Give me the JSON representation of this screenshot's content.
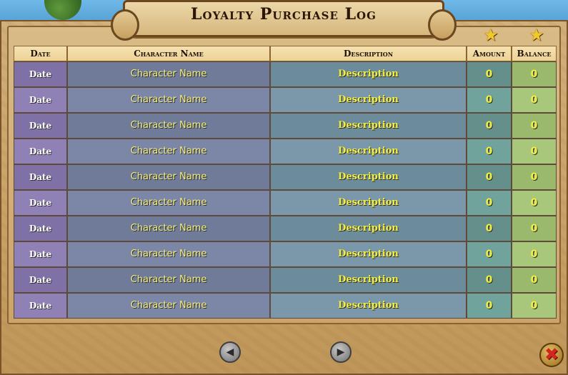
{
  "title": "Loyalty Purchase Log",
  "icons": {
    "amount_star": "star-icon",
    "balance_star": "star-icon",
    "prev": "chevron-left-icon",
    "next": "chevron-right-icon",
    "close": "close-icon"
  },
  "columns": {
    "date": "Date",
    "character": "Character Name",
    "description": "Description",
    "amount": "Amount",
    "balance": "Balance"
  },
  "rows": [
    {
      "date": "Date",
      "character": "Character Name",
      "description": "Description",
      "amount": "0",
      "balance": "0"
    },
    {
      "date": "Date",
      "character": "Character Name",
      "description": "Description",
      "amount": "0",
      "balance": "0"
    },
    {
      "date": "Date",
      "character": "Character Name",
      "description": "Description",
      "amount": "0",
      "balance": "0"
    },
    {
      "date": "Date",
      "character": "Character Name",
      "description": "Description",
      "amount": "0",
      "balance": "0"
    },
    {
      "date": "Date",
      "character": "Character Name",
      "description": "Description",
      "amount": "0",
      "balance": "0"
    },
    {
      "date": "Date",
      "character": "Character Name",
      "description": "Description",
      "amount": "0",
      "balance": "0"
    },
    {
      "date": "Date",
      "character": "Character Name",
      "description": "Description",
      "amount": "0",
      "balance": "0"
    },
    {
      "date": "Date",
      "character": "Character Name",
      "description": "Description",
      "amount": "0",
      "balance": "0"
    },
    {
      "date": "Date",
      "character": "Character Name",
      "description": "Description",
      "amount": "0",
      "balance": "0"
    },
    {
      "date": "Date",
      "character": "Character Name",
      "description": "Description",
      "amount": "0",
      "balance": "0"
    }
  ],
  "colors": {
    "frame": "#c8a36a",
    "title_border": "#6b4720",
    "amount_col": "#6fa39c",
    "balance_col": "#a9c77a",
    "text_yellow": "#f4ef3e"
  }
}
